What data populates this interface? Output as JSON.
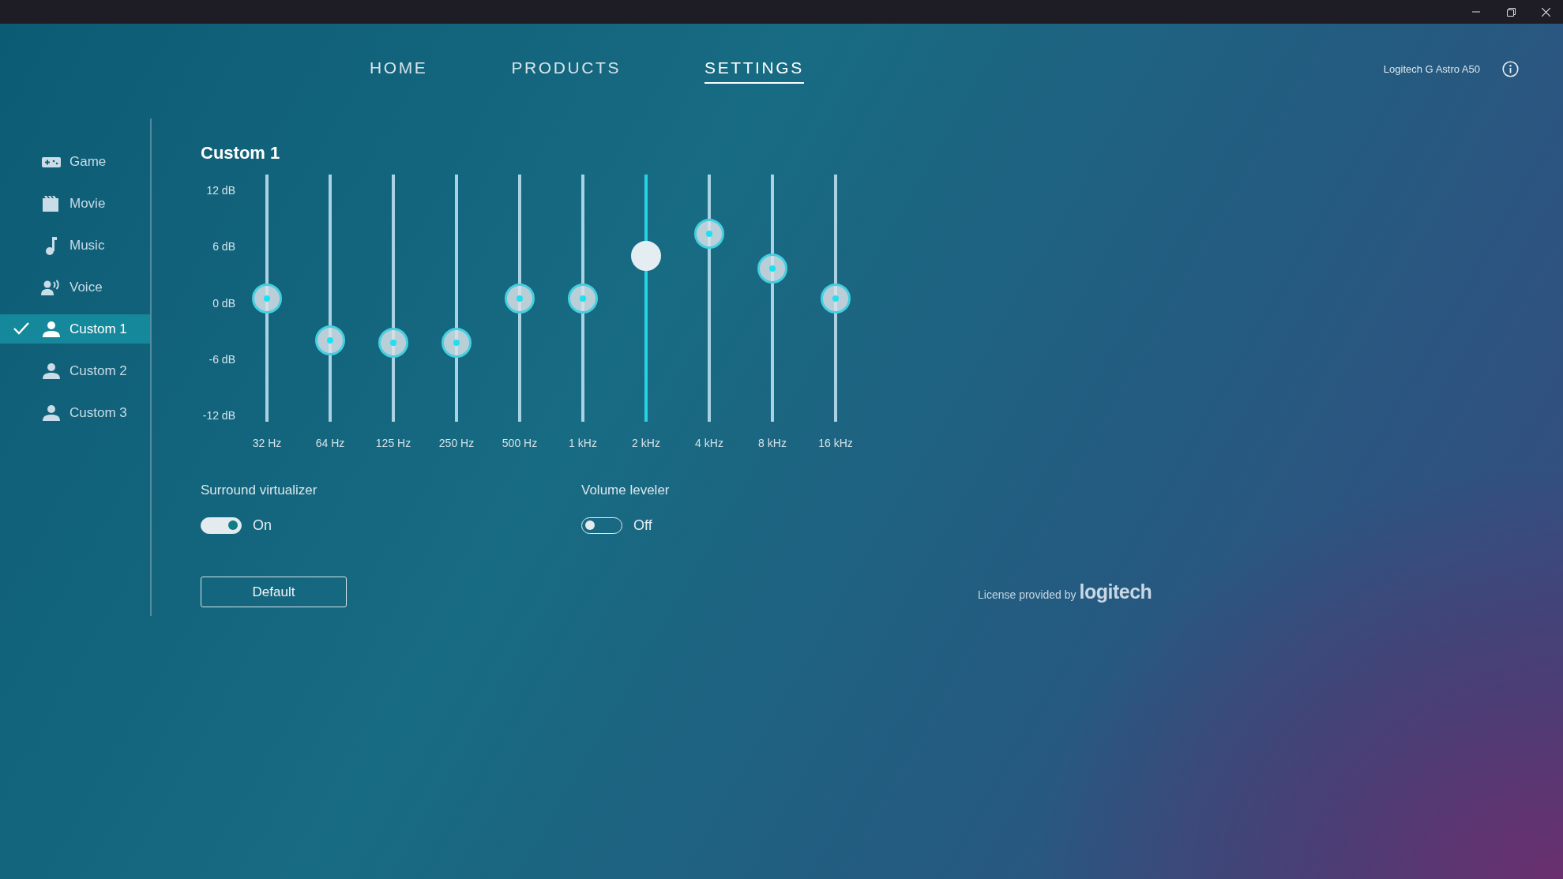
{
  "nav": {
    "tabs": [
      {
        "label": "HOME",
        "selected": false
      },
      {
        "label": "PRODUCTS",
        "selected": false
      },
      {
        "label": "SETTINGS",
        "selected": true
      }
    ],
    "device": "Logitech G Astro A50"
  },
  "sidebar": {
    "items": [
      {
        "label": "Game",
        "kind": "game",
        "selected": false
      },
      {
        "label": "Movie",
        "kind": "movie",
        "selected": false
      },
      {
        "label": "Music",
        "kind": "music",
        "selected": false
      },
      {
        "label": "Voice",
        "kind": "voice",
        "selected": false
      },
      {
        "label": "Custom 1",
        "kind": "custom",
        "selected": true
      },
      {
        "label": "Custom 2",
        "kind": "custom",
        "selected": false
      },
      {
        "label": "Custom 3",
        "kind": "custom",
        "selected": false
      }
    ]
  },
  "equalizer": {
    "title": "Custom 1",
    "scale": [
      "12 dB",
      "6 dB",
      "0 dB",
      "-6 dB",
      "-12 dB"
    ],
    "bands": [
      {
        "label": "32 Hz",
        "level": 0.5,
        "active": false
      },
      {
        "label": "64 Hz",
        "level": 0.33,
        "active": false
      },
      {
        "label": "125 Hz",
        "level": 0.32,
        "active": false
      },
      {
        "label": "250 Hz",
        "level": 0.32,
        "active": false
      },
      {
        "label": "500 Hz",
        "level": 0.5,
        "active": false
      },
      {
        "label": "1 kHz",
        "level": 0.5,
        "active": false
      },
      {
        "label": "2 kHz",
        "level": 0.67,
        "active": true
      },
      {
        "label": "4 kHz",
        "level": 0.76,
        "active": false
      },
      {
        "label": "8 kHz",
        "level": 0.62,
        "active": false
      },
      {
        "label": "16 kHz",
        "level": 0.5,
        "active": false
      }
    ]
  },
  "options": [
    {
      "label": "Surround virtualizer",
      "on": true,
      "state_text": "On"
    },
    {
      "label": "Volume leveler",
      "on": false,
      "state_text": "Off"
    }
  ],
  "default_button": "Default",
  "license": {
    "text": "License provided by",
    "brand": "logitech"
  }
}
